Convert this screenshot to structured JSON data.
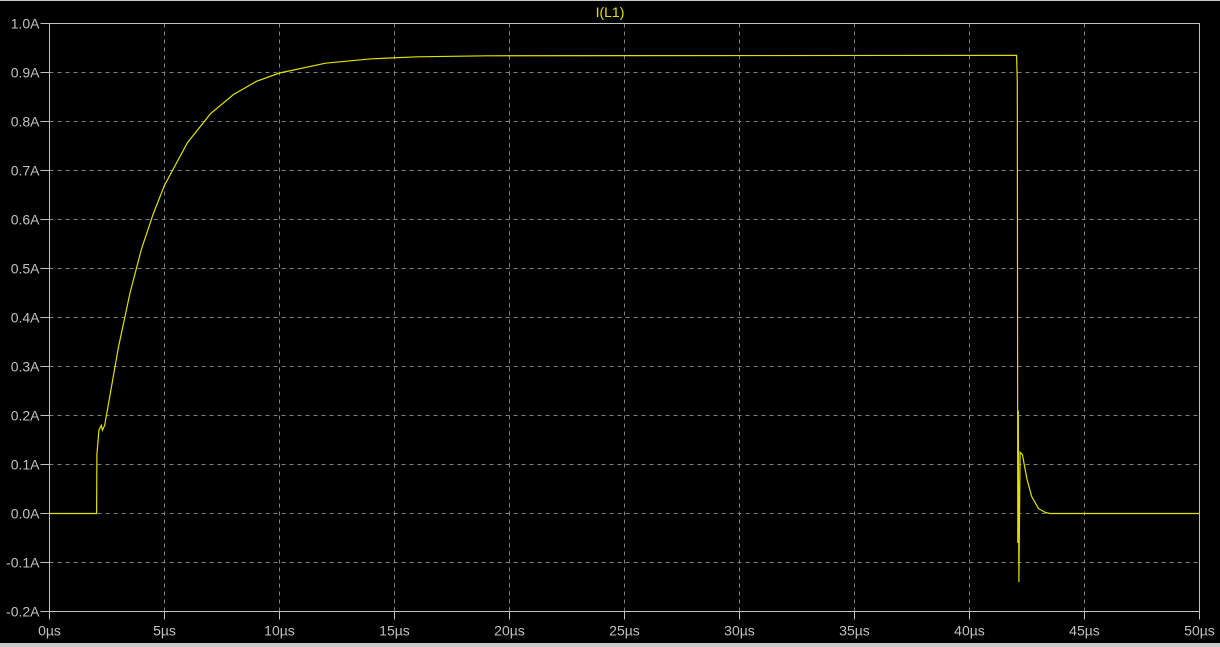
{
  "chart_data": {
    "type": "line",
    "title": "I(L1)",
    "xlabel": "",
    "ylabel": "",
    "xlim": [
      0,
      50
    ],
    "ylim": [
      -0.2,
      1.0
    ],
    "grid": true,
    "x_ticks": [
      "0µs",
      "5µs",
      "10µs",
      "15µs",
      "20µs",
      "25µs",
      "30µs",
      "35µs",
      "40µs",
      "45µs",
      "50µs"
    ],
    "y_ticks": [
      "1.0A",
      "0.9A",
      "0.8A",
      "0.7A",
      "0.6A",
      "0.5A",
      "0.4A",
      "0.3A",
      "0.2A",
      "0.1A",
      "0.0A",
      "-0.1A",
      "-0.2A"
    ],
    "colors": {
      "trace": "#e0e000",
      "grid": "#808080",
      "axis": "#c0c0c0",
      "background": "#000000"
    },
    "series": [
      {
        "name": "I(L1)",
        "x_unit": "µs",
        "y_unit": "A",
        "x": [
          0,
          2.05,
          2.06,
          2.15,
          2.25,
          2.3,
          2.4,
          3,
          3.5,
          4,
          4.5,
          5,
          6,
          7,
          8,
          9,
          10,
          12,
          14,
          16,
          19,
          42.05,
          42.08,
          42.1,
          42.12,
          42.15,
          42.2,
          42.3,
          42.5,
          42.7,
          43.0,
          43.3,
          43.5,
          50
        ],
        "y": [
          0,
          0,
          0.12,
          0.17,
          0.18,
          0.17,
          0.18,
          0.34,
          0.45,
          0.54,
          0.61,
          0.67,
          0.757,
          0.816,
          0.855,
          0.882,
          0.899,
          0.919,
          0.928,
          0.932,
          0.934,
          0.935,
          0.88,
          -0.06,
          0.21,
          -0.14,
          0.125,
          0.12,
          0.07,
          0.035,
          0.01,
          0.002,
          0,
          0
        ]
      }
    ]
  }
}
